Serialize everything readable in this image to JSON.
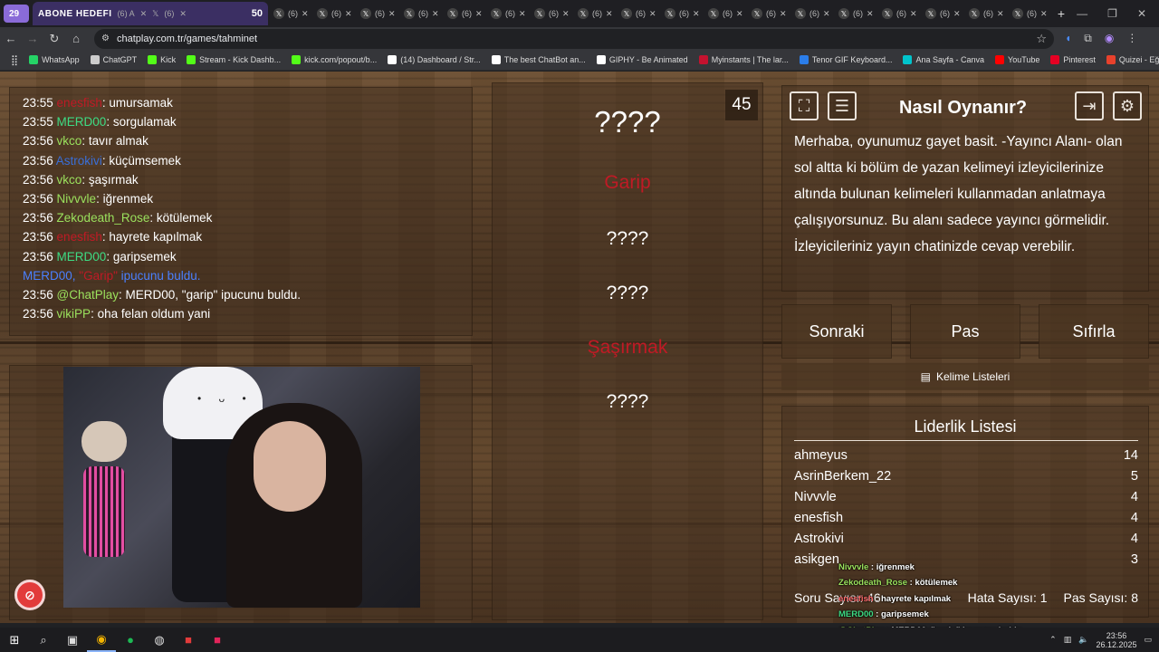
{
  "browser": {
    "tab_counter": "29",
    "active_tab": {
      "title": "ABONE HEDEFI",
      "mini": "(6) A",
      "num": "50"
    },
    "other_tab_label": "(6)",
    "url": "chatplay.com.tr/games/tahminet",
    "bookmarks": [
      {
        "label": "WhatsApp",
        "color": "#25d366"
      },
      {
        "label": "ChatGPT",
        "color": "#cccccc"
      },
      {
        "label": "Kick",
        "color": "#53fc18"
      },
      {
        "label": "Stream - Kick Dashb...",
        "color": "#53fc18"
      },
      {
        "label": "kick.com/popout/b...",
        "color": "#53fc18"
      },
      {
        "label": "(14) Dashboard / Str...",
        "color": "#ffffff"
      },
      {
        "label": "The best ChatBot an...",
        "color": "#ffffff"
      },
      {
        "label": "GIPHY - Be Animated",
        "color": "#ffffff"
      },
      {
        "label": "Myinstants | The lar...",
        "color": "#c4122f"
      },
      {
        "label": "Tenor GIF Keyboard...",
        "color": "#2b7de9"
      },
      {
        "label": "Ana Sayfa - Canva",
        "color": "#00c4cc"
      },
      {
        "label": "YouTube",
        "color": "#ff0000"
      },
      {
        "label": "Pinterest",
        "color": "#e60023"
      },
      {
        "label": "Quizei - Eğlenceli ve...",
        "color": "#e8412c"
      }
    ]
  },
  "chat": {
    "lines": [
      {
        "time": "23:55",
        "user": "enesfish",
        "color": "#c01a25",
        "msg": ": umursamak"
      },
      {
        "time": "23:55",
        "user": "MERD00",
        "color": "#3ddc84",
        "msg": ": sorgulamak"
      },
      {
        "time": "23:56",
        "user": "vkco",
        "color": "#9be15d",
        "msg": ": tavır almak"
      },
      {
        "time": "23:56",
        "user": "Astrokivi",
        "color": "#3a6fd8",
        "msg": ": küçümsemek"
      },
      {
        "time": "23:56",
        "user": "vkco",
        "color": "#9be15d",
        "msg": ": şaşırmak"
      },
      {
        "time": "23:56",
        "user": "Nivvvle",
        "color": "#9be15d",
        "msg": ": iğrenmek"
      },
      {
        "time": "23:56",
        "user": "Zekodeath_Rose",
        "color": "#9be15d",
        "msg": ": kötülemek"
      },
      {
        "time": "23:56",
        "user": "enesfish",
        "color": "#c01a25",
        "msg": ": hayrete kapılmak"
      },
      {
        "time": "23:56",
        "user": "MERD00",
        "color": "#3ddc84",
        "msg": ": garipsemek"
      }
    ],
    "system": {
      "pre": "MERD00, ",
      "hint": "\"Garip\"",
      "post": " ipucunu buldu."
    },
    "after": [
      {
        "time": "23:56",
        "user": "@ChatPlay",
        "color": "#9be15d",
        "msg": ": MERD00, \"garip\" ipucunu buldu."
      },
      {
        "time": "23:56",
        "user": "vikiPP",
        "color": "#9be15d",
        "msg": ": oha felan oldum yani"
      }
    ]
  },
  "game": {
    "timer": "45",
    "words": [
      {
        "text": "????",
        "kind": "big"
      },
      {
        "text": "Garip",
        "kind": "hint"
      },
      {
        "text": "????",
        "kind": "normal"
      },
      {
        "text": "????",
        "kind": "normal"
      },
      {
        "text": "Şaşırmak",
        "kind": "hint"
      },
      {
        "text": "????",
        "kind": "normal"
      }
    ]
  },
  "howto": {
    "title": "Nasıl Oynanır?",
    "text": "Merhaba, oyunumuz gayet basit. -Yayıncı Alanı- olan sol altta ki bölüm de yazan kelimeyi izleyicilerinize altında bulunan kelimeleri kullanmadan anlatmaya çalışıyorsunuz. Bu alanı sadece yayıncı görmelidir. İzleyicileriniz yayın chatinizde cevap verebilir."
  },
  "controls": {
    "next": "Sonraki",
    "pass": "Pas",
    "reset": "Sıfırla",
    "word_lists": "Kelime Listeleri"
  },
  "leaderboard": {
    "title": "Liderlik Listesi",
    "rows": [
      {
        "name": "ahmeyus",
        "score": "14"
      },
      {
        "name": "AsrinBerkem_22",
        "score": "5"
      },
      {
        "name": "Nivvvle",
        "score": "4"
      },
      {
        "name": "enesfish",
        "score": "4"
      },
      {
        "name": "Astrokivi",
        "score": "4"
      },
      {
        "name": "asikgen",
        "score": "3"
      }
    ],
    "question_count": "Soru Sayısı: 46",
    "error_count": "Hata Sayısı: 1",
    "pass_count": "Pas Sayısı: 8"
  },
  "overlay": [
    {
      "user": "Nivvvle",
      "color": "#9be15d",
      "msg": " : iğrenmek"
    },
    {
      "user": "Zekodeath_Rose",
      "color": "#9be15d",
      "msg": " : kötülemek"
    },
    {
      "user": "enesfish",
      "color": "#ff6b6b",
      "msg": " : hayrete kapılmak"
    },
    {
      "user": "MERD00",
      "color": "#3ddc84",
      "msg": " : garipsemek"
    },
    {
      "user": "@ChatPlay",
      "color": "#9be15d",
      "msg": " : MERD00, \"garip\" ipucunu buldu."
    },
    {
      "user": "vikiPP",
      "color": "#9be15d",
      "msg": " : oha felan oldum yani"
    }
  ],
  "taskbar": {
    "time": "23:56",
    "date": "26.12.2025"
  }
}
